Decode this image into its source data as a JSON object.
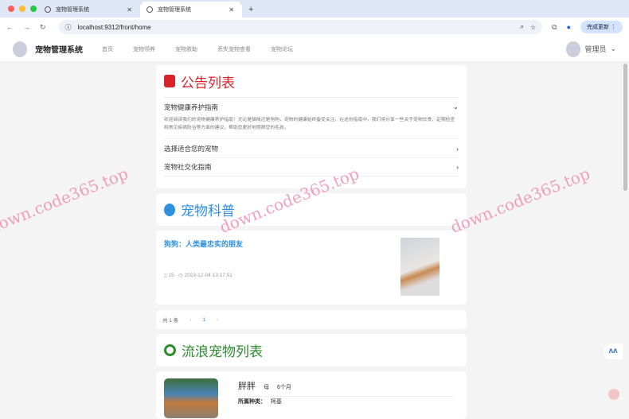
{
  "browser": {
    "tabs": [
      {
        "title": "宠物管理系统"
      },
      {
        "title": "宠物管理系统"
      }
    ],
    "url": "localhost:9312/front/home",
    "update_button": "完成更新"
  },
  "header": {
    "brand": "宠物管理系统",
    "nav": [
      "首页",
      "宠物领养",
      "宠物救助",
      "丢失宠物查看",
      "宠物论坛"
    ],
    "user": "管理员"
  },
  "notices": {
    "title": "公告列表",
    "items": [
      {
        "title": "宠物健康养护指南",
        "content": "欢迎阅读我们的宠物健康养护指南！无论是猫咪还是狗狗，宠物的健康始终备受关注。在这份指南中，我们将分享一些关于宠物饮食、定期检查和常见疾病防治等方面的建议，帮助您更好地照顾您的毛孩。"
      },
      {
        "title": "选择适合您的宠物"
      },
      {
        "title": "宠物社交化指南"
      }
    ]
  },
  "science": {
    "title": "宠物科普",
    "article": {
      "title": "狗狗：人类最忠实的朋友",
      "views": "15",
      "time": "2023-12-04 13:17:51"
    },
    "pagination": {
      "total": "共 1 条",
      "page": "1"
    }
  },
  "strays": {
    "title": "流浪宠物列表",
    "pet": {
      "name": "胖胖",
      "gender": "母",
      "age": "6个月",
      "breed_label": "所属种类：",
      "breed": "柯基"
    }
  },
  "watermark": "down.code365.top",
  "colors": {
    "notice": "#d7242a",
    "science": "#2f8fe0",
    "strays": "#2e8b2e"
  }
}
